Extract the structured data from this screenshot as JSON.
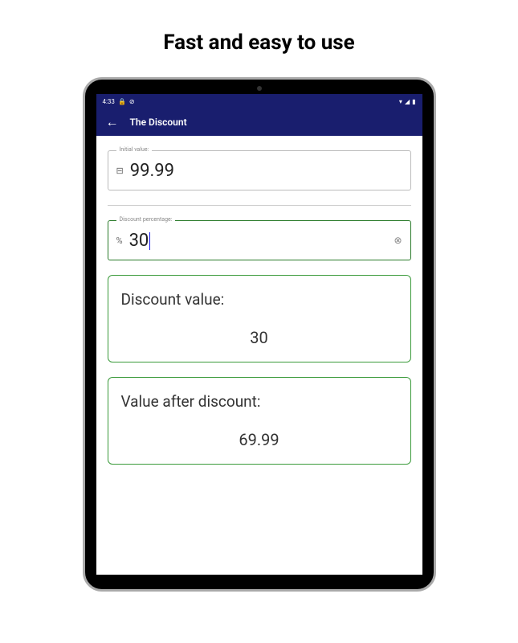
{
  "headline": "Fast and easy to use",
  "status_bar": {
    "time": "4:33"
  },
  "app_bar": {
    "title": "The Discount"
  },
  "inputs": {
    "initial_value": {
      "label": "Initial value:",
      "prefix": "⊟",
      "value": "99.99"
    },
    "discount_percentage": {
      "label": "Discount percentage:",
      "prefix": "%",
      "value": "30"
    }
  },
  "results": {
    "discount_value": {
      "label": "Discount value:",
      "value": "30"
    },
    "value_after_discount": {
      "label": "Value after discount:",
      "value": "69.99"
    }
  }
}
